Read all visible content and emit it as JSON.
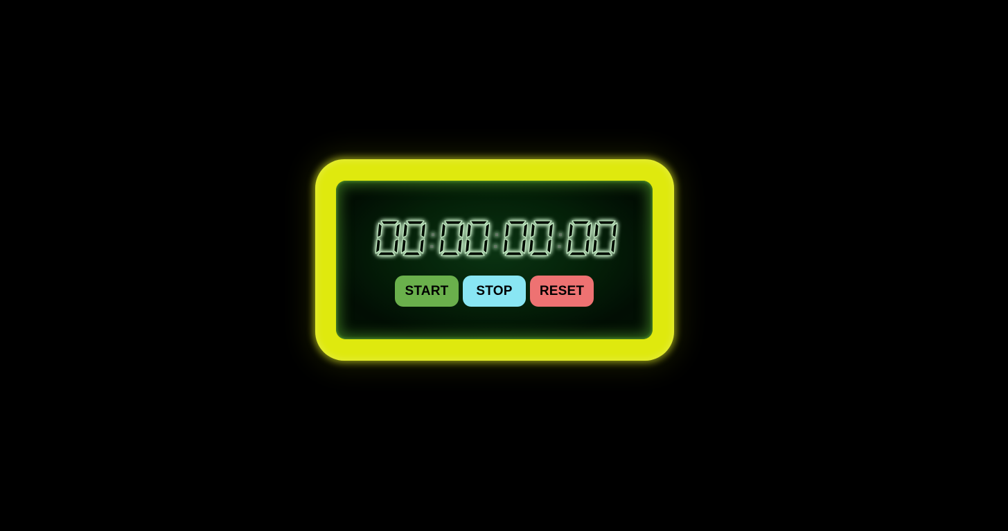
{
  "timer": {
    "display": "00:00:00:00",
    "digit_groups": [
      "00",
      "00",
      "00",
      "00"
    ],
    "separator": ":"
  },
  "controls": {
    "start_label": "START",
    "stop_label": "STOP",
    "reset_label": "RESET"
  },
  "colors": {
    "background": "#000000",
    "frame": "#dfe90e",
    "screen": "#042008",
    "segment_glow": "#c8f0c8",
    "start_button": "#6ab04c",
    "stop_button": "#89e6f3",
    "reset_button": "#ee7272"
  }
}
